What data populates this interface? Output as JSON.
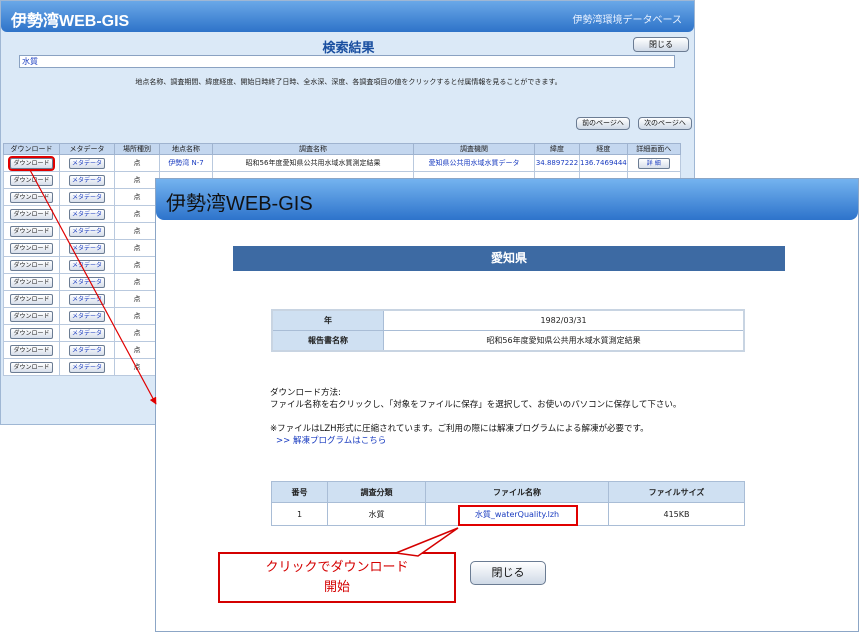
{
  "back_window": {
    "app_title": "伊勢湾WEB-GIS",
    "subtitle": "伊勢湾環境データベース",
    "page_title": "検索結果",
    "close_label": "閉じる",
    "search_value": "水質",
    "instruction": "地点名称、調査期間、緯度経度、開始日時終了日時、全水深、深度、各調査項目の値をクリックすると付属情報を見ることができます。",
    "prev_page_label": "前のページへ",
    "next_page_label": "次のページへ",
    "columns": [
      "ダウンロード",
      "メタデータ",
      "場所種別",
      "地点名称",
      "調査名称",
      "調査機関",
      "緯度",
      "経度",
      "詳細画面へ"
    ],
    "download_label": "ダウンロード",
    "metadata_label": "メタデータ",
    "point_type": "点",
    "first_row": {
      "point_name": "伊勢湾 N-7",
      "survey_name": "昭和56年度愛知県公共用水域水質測定結果",
      "agency": "愛知県公共用水域水質データ",
      "lat": "34.8897222",
      "lon": "136.7469444",
      "detail_label": "詳 細"
    }
  },
  "front_window": {
    "app_title": "伊勢湾WEB-GIS",
    "prefecture": "愛知県",
    "info": [
      {
        "label": "年",
        "value": "1982/03/31"
      },
      {
        "label": "報告書名称",
        "value": "昭和56年度愛知県公共用水域水質測定結果"
      }
    ],
    "download_method_title": "ダウンロード方法:",
    "download_method_text": "ファイル名称を右クリックし、「対象をファイルに保存」を選択して、お使いのパソコンに保存して下さい。",
    "lzh_note": "※ファイルはLZH形式に圧縮されています。ご利用の際には解凍プログラムによる解凍が必要です。",
    "decompress_link": ">> 解凍プログラムはこちら",
    "file_table": {
      "headers": [
        "番号",
        "調査分類",
        "ファイル名称",
        "ファイルサイズ"
      ],
      "row": {
        "no": "1",
        "category": "水質",
        "file_name": "水質_waterQuality.lzh",
        "size": "415KB"
      }
    },
    "close_label": "閉じる"
  },
  "annotation": {
    "line1": "クリックでダウンロード",
    "line2": "開始",
    "color": "#e00000"
  }
}
